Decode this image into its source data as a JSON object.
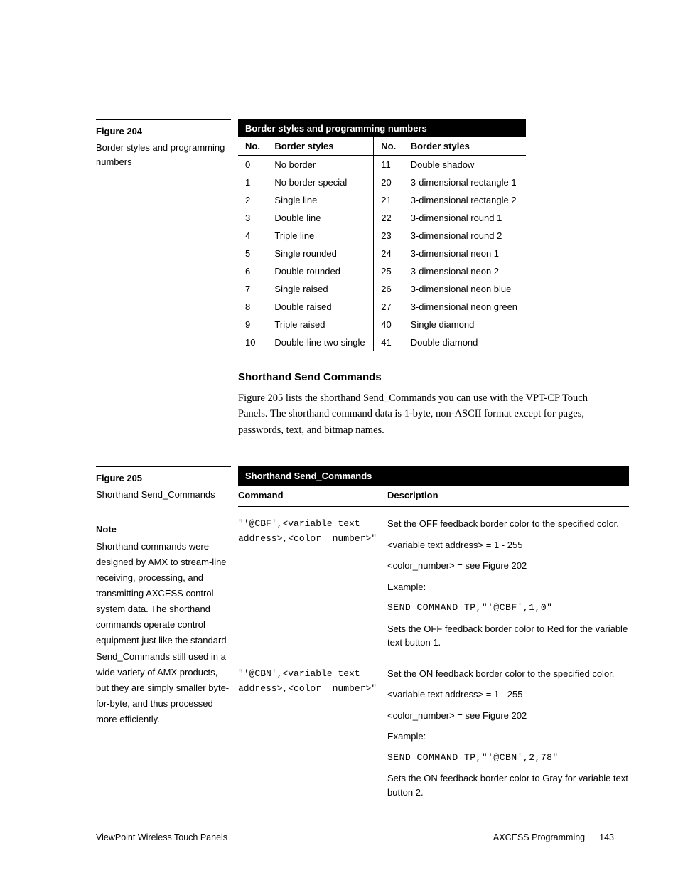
{
  "figure204": {
    "label": "Figure 204",
    "caption": "Border styles and programming numbers"
  },
  "borderStylesTable": {
    "title": "Border styles and programming numbers",
    "headers": {
      "no": "No.",
      "style": "Border styles"
    },
    "left": [
      {
        "no": "0",
        "style": "No border"
      },
      {
        "no": "1",
        "style": "No border special"
      },
      {
        "no": "2",
        "style": "Single line"
      },
      {
        "no": "3",
        "style": "Double line"
      },
      {
        "no": "4",
        "style": "Triple line"
      },
      {
        "no": "5",
        "style": "Single rounded"
      },
      {
        "no": "6",
        "style": "Double rounded"
      },
      {
        "no": "7",
        "style": "Single raised"
      },
      {
        "no": "8",
        "style": "Double raised"
      },
      {
        "no": "9",
        "style": "Triple raised"
      },
      {
        "no": "10",
        "style": "Double-line two single"
      }
    ],
    "right": [
      {
        "no": "11",
        "style": "Double shadow"
      },
      {
        "no": "20",
        "style": "3-dimensional rectangle 1"
      },
      {
        "no": "21",
        "style": "3-dimensional rectangle 2"
      },
      {
        "no": "22",
        "style": "3-dimensional round 1"
      },
      {
        "no": "23",
        "style": "3-dimensional round 2"
      },
      {
        "no": "24",
        "style": "3-dimensional neon 1"
      },
      {
        "no": "25",
        "style": "3-dimensional neon 2"
      },
      {
        "no": "26",
        "style": "3-dimensional neon blue"
      },
      {
        "no": "27",
        "style": "3-dimensional neon green"
      },
      {
        "no": "40",
        "style": "Single diamond"
      },
      {
        "no": "41",
        "style": "Double diamond"
      }
    ]
  },
  "section": {
    "heading": "Shorthand Send Commands",
    "body": "Figure 205 lists the shorthand Send_Commands you can use with the VPT-CP Touch Panels. The shorthand command data is 1-byte, non-ASCII format except for pages, passwords, text, and bitmap names."
  },
  "figure205": {
    "label": "Figure 205",
    "caption": "Shorthand Send_Commands"
  },
  "note": {
    "label": "Note",
    "body": "Shorthand commands were designed by AMX to stream-line receiving, processing, and transmitting AXCESS control system data. The shorthand commands operate control equipment just like the standard Send_Commands still used in a wide variety of AMX products, but they are simply smaller byte-for-byte, and thus processed more efficiently."
  },
  "shorthandTable": {
    "title": "Shorthand Send_Commands",
    "headers": {
      "cmd": "Command",
      "desc": "Description"
    },
    "rows": [
      {
        "cmd": "\"'@CBF',<variable text address>,<color_ number>\"",
        "d1": "Set the OFF feedback border color to the specified color.",
        "d2": "<variable text address> = 1 - 255",
        "d3": "<color_number> = see Figure 202",
        "d4": "Example:",
        "d5": "SEND_COMMAND TP,\"'@CBF',1,0\"",
        "d6": "Sets the OFF feedback border color to Red for the variable text button 1."
      },
      {
        "cmd": "\"'@CBN',<variable text address>,<color_ number>\"",
        "d1": "Set the ON feedback border color to the specified color.",
        "d2": "<variable text address> = 1 - 255",
        "d3": "<color_number> = see Figure 202",
        "d4": "Example:",
        "d5": "SEND_COMMAND TP,\"'@CBN',2,78\"",
        "d6": "Sets the ON feedback border color to Gray for variable text button 2."
      }
    ]
  },
  "footer": {
    "left": "ViewPoint Wireless Touch Panels",
    "rightLabel": "AXCESS Programming",
    "page": "143"
  }
}
